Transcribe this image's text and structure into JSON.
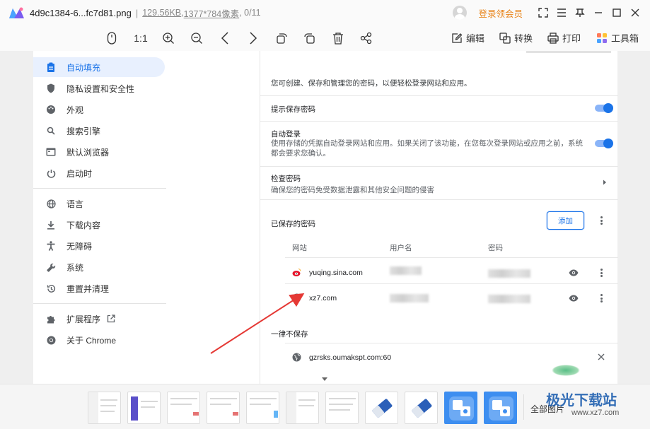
{
  "titlebar": {
    "filename": "4d9c1384-6...fc7d81.png",
    "filesize": "129.56KB",
    "dimensions": "1377*784像素",
    "index": "0/11",
    "vip_label": "登录领会员"
  },
  "toolbar": {
    "zoom_original": "1:1",
    "edit_label": "编辑",
    "convert_label": "转换",
    "print_label": "打印",
    "toolbox_label": "工具箱"
  },
  "sidebar": {
    "items": [
      {
        "label": "自动填充",
        "icon": "clipboard-icon"
      },
      {
        "label": "隐私设置和安全性",
        "icon": "shield-icon"
      },
      {
        "label": "外观",
        "icon": "palette-icon"
      },
      {
        "label": "搜索引擎",
        "icon": "search-icon"
      },
      {
        "label": "默认浏览器",
        "icon": "browser-icon"
      },
      {
        "label": "启动时",
        "icon": "power-icon"
      },
      {
        "label": "语言",
        "icon": "globe-icon"
      },
      {
        "label": "下载内容",
        "icon": "download-icon"
      },
      {
        "label": "无障碍",
        "icon": "accessibility-icon"
      },
      {
        "label": "系统",
        "icon": "wrench-icon"
      },
      {
        "label": "重置并清理",
        "icon": "history-icon"
      },
      {
        "label": "扩展程序",
        "icon": "puzzle-icon"
      },
      {
        "label": "关于 Chrome",
        "icon": "chrome-icon"
      }
    ]
  },
  "passwords": {
    "intro": "您可创建、保存和管理您的密码，以便轻松登录网站和应用。",
    "offer_save_label": "提示保存密码",
    "auto_signin_label": "自动登录",
    "auto_signin_desc": "使用存储的凭据自动登录网站和应用。如果关闭了该功能，在您每次登录网站或应用之前，系统都会要求您确认。",
    "check_label": "检查密码",
    "check_desc": "确保您的密码免受数据泄露和其他安全问题的侵害",
    "saved_label": "已保存的密码",
    "add_label": "添加",
    "col_site": "网站",
    "col_user": "用户名",
    "col_password": "密码",
    "entries": [
      {
        "site": "yuqing.sina.com"
      },
      {
        "site": "xz7.com"
      }
    ],
    "never_label": "一律不保存",
    "never_entries": [
      {
        "site": "gzrsks.oumakspt.com:60"
      }
    ]
  },
  "bottom": {
    "all_pics_label": "全部图片",
    "watermark_main": "极光下载站",
    "watermark_sub": "www.xz7.com"
  },
  "colors": {
    "accent": "#1a73e8",
    "vip": "#e8841a",
    "arrow": "#e53935"
  }
}
